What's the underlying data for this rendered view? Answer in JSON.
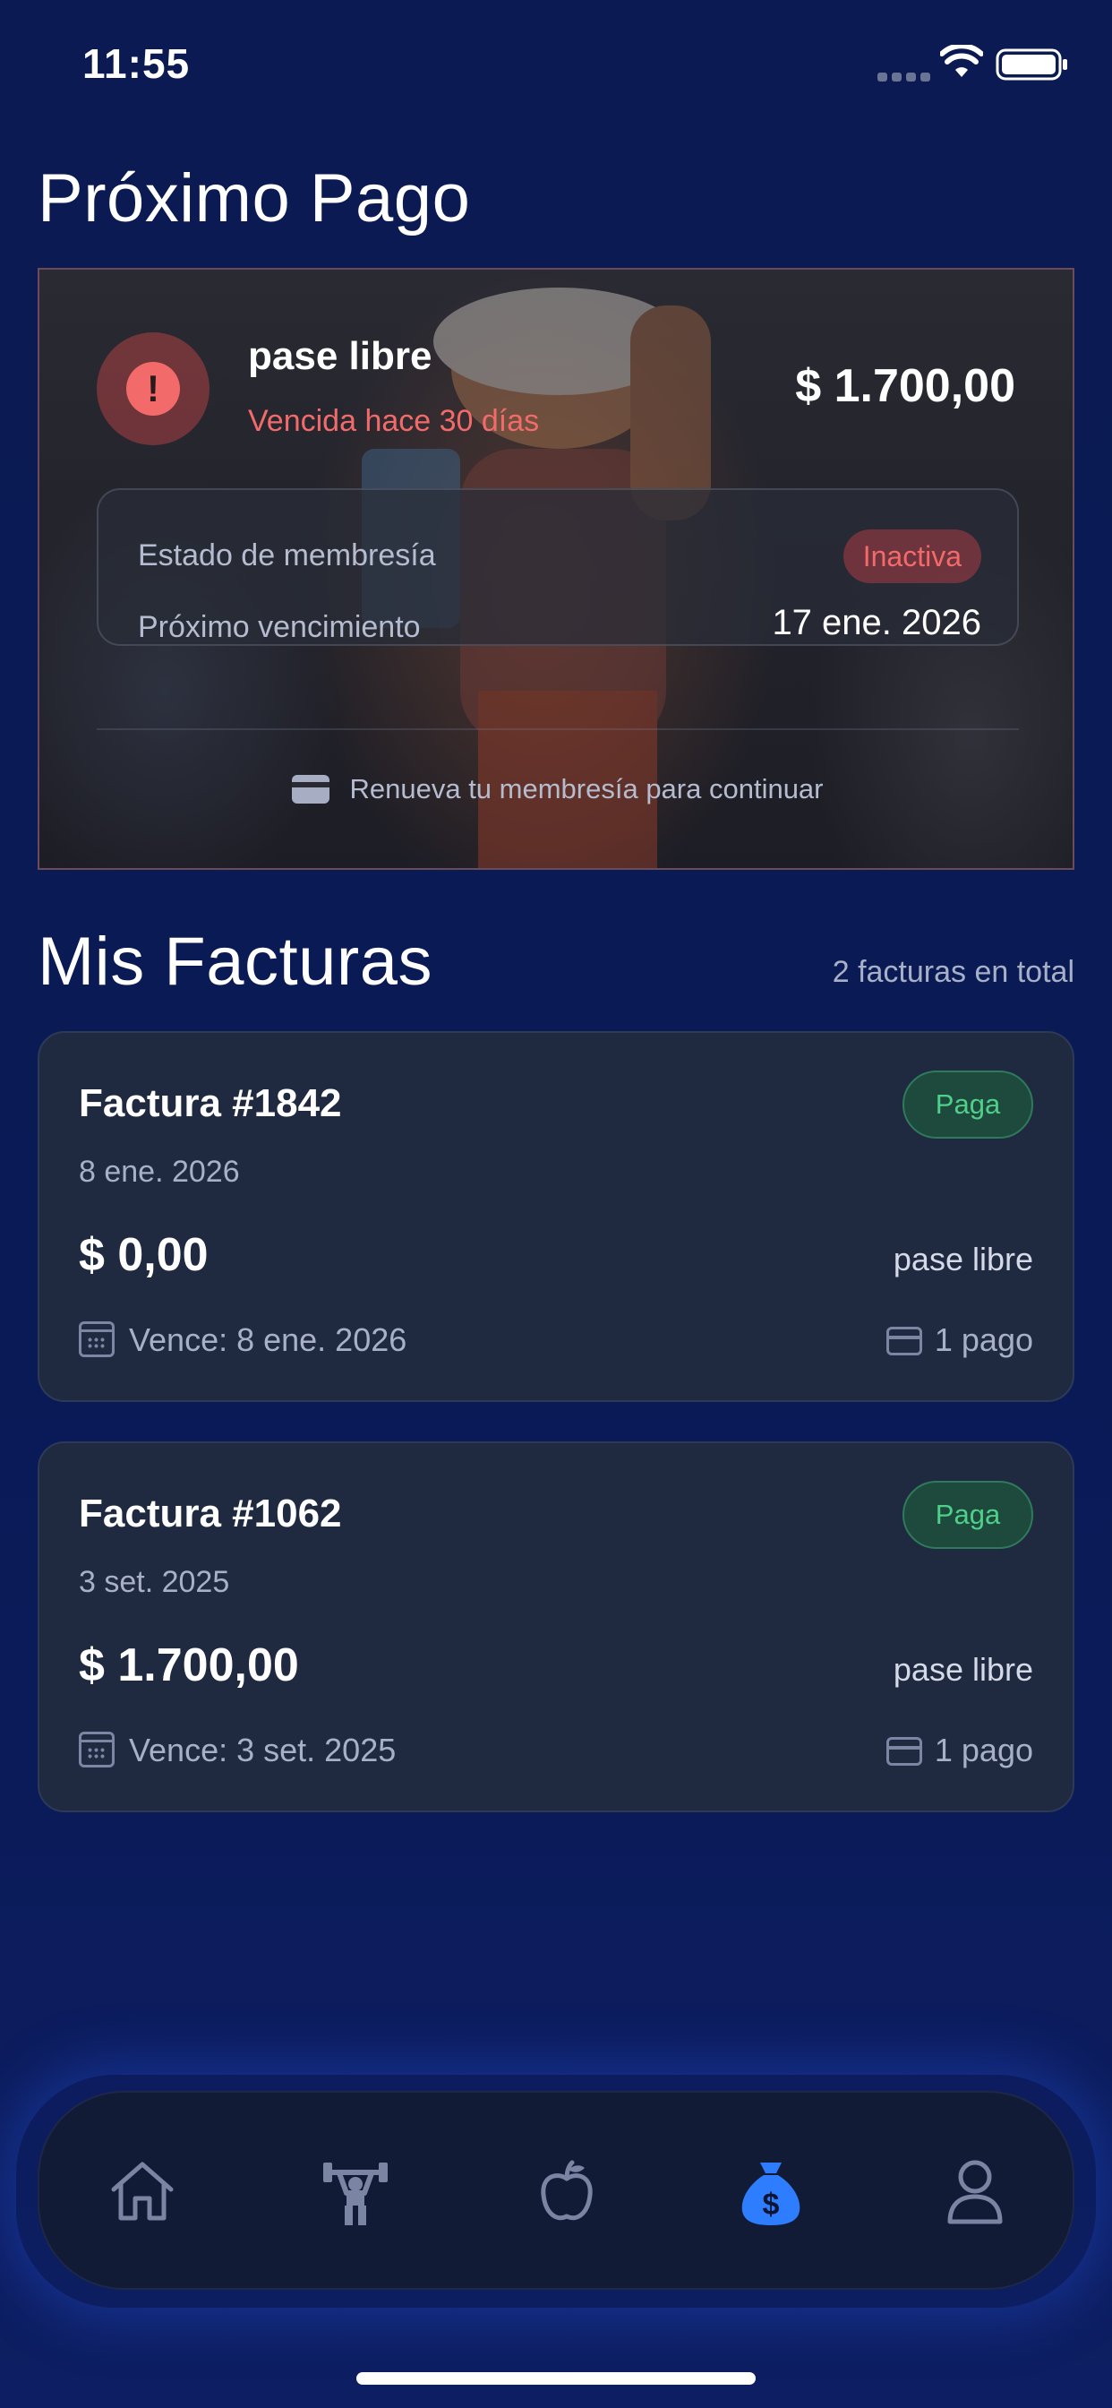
{
  "status_bar": {
    "time": "11:55"
  },
  "next_payment": {
    "section_title": "Próximo Pago",
    "plan_name": "pase libre",
    "overdue_text": "Vencida hace 30 días",
    "amount": "$ 1.700,00",
    "membership_status_label": "Estado de membresía",
    "membership_status": "Inactiva",
    "next_due_label": "Próximo vencimiento",
    "next_due_date": "17 ene. 2026",
    "renew_message": "Renueva tu membresía para continuar"
  },
  "invoices": {
    "section_title": "Mis Facturas",
    "total_text": "2 facturas en total",
    "items": [
      {
        "title": "Factura #1842",
        "date": "8 ene. 2026",
        "status": "Paga",
        "amount": "$ 0,00",
        "plan": "pase libre",
        "due": "Vence: 8 ene. 2026",
        "payments": "1 pago"
      },
      {
        "title": "Factura #1062",
        "date": "3 set. 2025",
        "status": "Paga",
        "amount": "$ 1.700,00",
        "plan": "pase libre",
        "due": "Vence: 3 set. 2025",
        "payments": "1 pago"
      }
    ]
  },
  "bottom_nav": {
    "items": [
      {
        "icon": "home-icon",
        "active": false
      },
      {
        "icon": "weightlifter-icon",
        "active": false
      },
      {
        "icon": "apple-icon",
        "active": false
      },
      {
        "icon": "money-bag-icon",
        "active": true
      },
      {
        "icon": "user-icon",
        "active": false
      }
    ],
    "active_color": "#2f7dff",
    "inactive_color": "#7a85a3"
  },
  "colors": {
    "background": "#0b1a52",
    "card": "#1f2a40",
    "danger": "#f26a6a",
    "success": "#4fd08a"
  }
}
